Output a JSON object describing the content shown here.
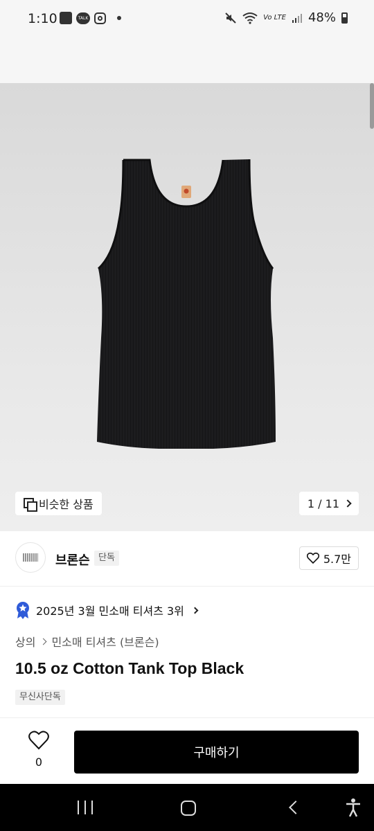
{
  "status_bar": {
    "time": "1:10",
    "talk_label": "TALK",
    "battery": "48%",
    "network_label": "Vo LTE"
  },
  "product_image": {
    "alt": "black ribbed cotton tank top",
    "similar_button_label": "비슷한 상품",
    "page_indicator": "1 / 11"
  },
  "brand": {
    "name": "브론슨",
    "badge": "단독",
    "like_count": "5.7만"
  },
  "ranking": {
    "text": "2025년 3월 민소매 티셔츠 3위"
  },
  "breadcrumb": {
    "category": "상의",
    "subcategory": "민소매 티셔츠 (브론슨)"
  },
  "product": {
    "title": "10.5 oz Cotton Tank Top Black",
    "exclusive_tag": "무신사단독"
  },
  "bottom_bar": {
    "wish_count": "0",
    "buy_label": "구매하기"
  },
  "colors": {
    "accent_medal": "#2f5bd8",
    "buy_button": "#000000"
  }
}
